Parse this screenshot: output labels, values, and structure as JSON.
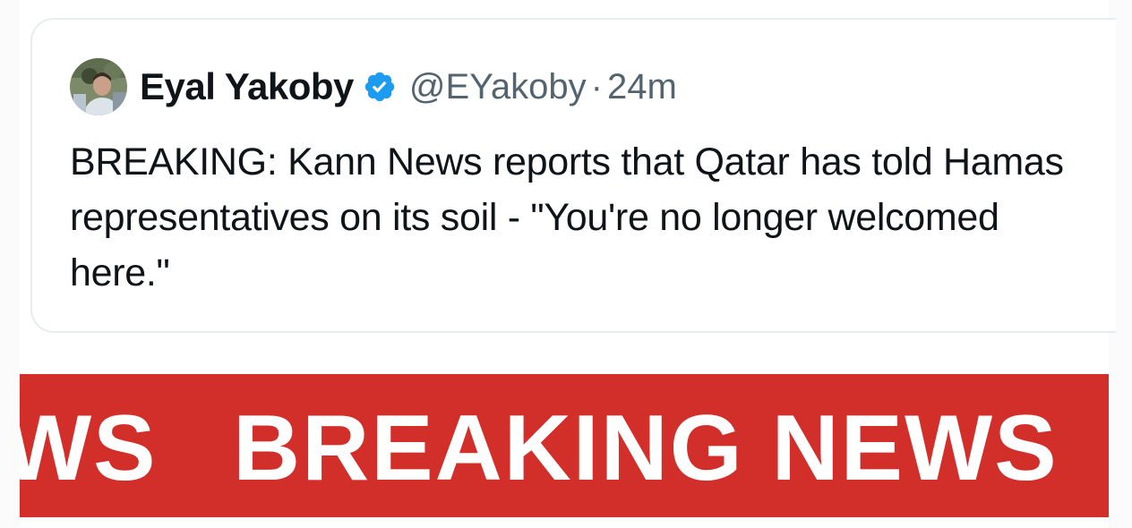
{
  "tweet": {
    "display_name": "Eyal Yakoby",
    "verified_icon": "verified-badge-icon",
    "handle": "@EYakoby",
    "separator": "·",
    "time": "24m",
    "text": "BREAKING: Kann News reports that Qatar has told Hamas representatives on its soil - \"You're no longer welcomed here.\""
  },
  "banner": {
    "fragment": "WS",
    "headline": "BREAKING NEWS",
    "color": "#d32f2a"
  },
  "colors": {
    "text_primary": "#0f1419",
    "text_secondary": "#536471",
    "verified_blue": "#1d9bf0"
  }
}
